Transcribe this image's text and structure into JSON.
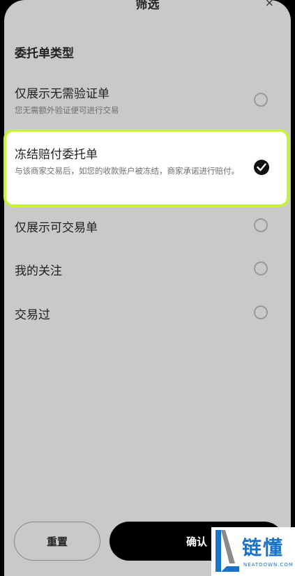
{
  "sheet": {
    "title": "筛选",
    "close": "×"
  },
  "section": {
    "title": "委托单类型"
  },
  "options": [
    {
      "label": "仅展示无需验证单",
      "desc": "您无需额外验证便可进行交易",
      "selected": false
    },
    {
      "label": "冻结赔付委托单",
      "desc": "与该商家交易后，如您的收款账户被冻结，商家承诺进行赔付。",
      "selected": true
    },
    {
      "label": "仅展示可交易单",
      "selected": false
    },
    {
      "label": "我的关注",
      "selected": false
    },
    {
      "label": "交易过",
      "selected": false
    }
  ],
  "buttons": {
    "reset": "重置",
    "confirm": "确认"
  },
  "watermark": {
    "text": "链懂",
    "sub": "NEATDOWN.COM"
  },
  "colors": {
    "accent": "#c6f23f",
    "sheet_bg": "#c9c9c9",
    "primary_button": "#000000"
  }
}
